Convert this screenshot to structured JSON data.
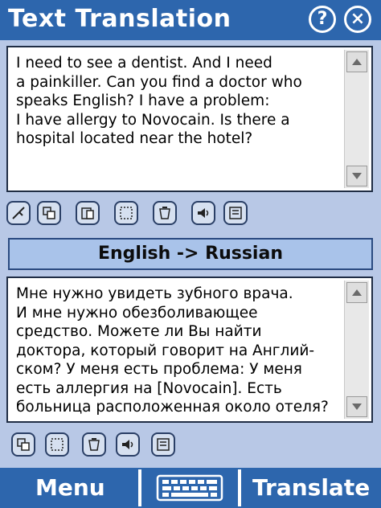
{
  "window": {
    "title": "Text Translation",
    "help_label": "?",
    "close_label": "×"
  },
  "source": {
    "text": "I need to see a dentist. And I need\na painkiller.  Can you find a doctor who\nspeaks English? I have a problem:\nI have allergy to Novocain. Is there a\nhospital located near the hotel?"
  },
  "source_tools": [
    "paste-icon",
    "copy-icon",
    "clipboard-icon",
    "select-icon",
    "clear-icon",
    "speak-icon",
    "dictionary-icon"
  ],
  "direction": {
    "label": "English -> Russian"
  },
  "target": {
    "text": "Мне нужно увидеть зубного врача.\nИ мне нужно обезболивающее\nсредство. Можете ли Вы найти\nдоктора, который говорит на Англий-\nском? У меня есть проблема: У меня\nесть аллергия на [Novocain]. Есть\nбольница расположенная около отеля?"
  },
  "target_tools": [
    "copy-icon",
    "select-icon",
    "clear-icon",
    "speak-icon",
    "dictionary-icon"
  ],
  "bottom_bar": {
    "menu_label": "Menu",
    "translate_label": "Translate",
    "keyboard_icon": "keyboard-icon"
  },
  "colors": {
    "bar": "#2d66ad",
    "panel": "#b8c8e6",
    "lang_bar": "#a9c3ea"
  }
}
